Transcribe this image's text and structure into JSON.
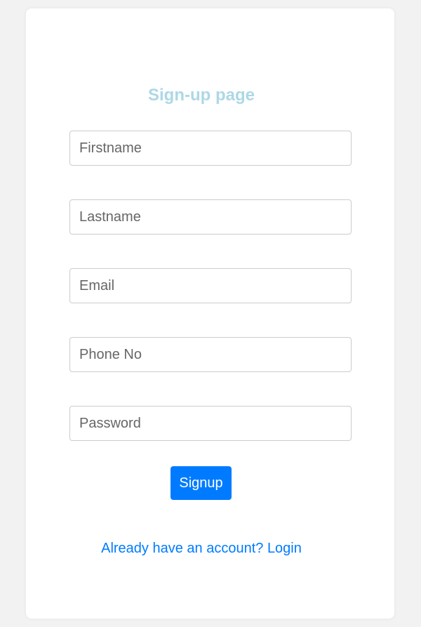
{
  "page": {
    "title": "Sign-up page"
  },
  "form": {
    "firstname_placeholder": "Firstname",
    "lastname_placeholder": "Lastname",
    "email_placeholder": "Email",
    "phone_placeholder": "Phone No",
    "password_placeholder": "Password",
    "firstname_value": "",
    "lastname_value": "",
    "email_value": "",
    "phone_value": "",
    "password_value": ""
  },
  "actions": {
    "signup_label": "Signup",
    "login_prompt": "Already have an account? ",
    "login_link": "Login"
  },
  "colors": {
    "title": "#add8e6",
    "accent": "#007bff",
    "background": "#f2f2f2",
    "card": "#ffffff"
  }
}
